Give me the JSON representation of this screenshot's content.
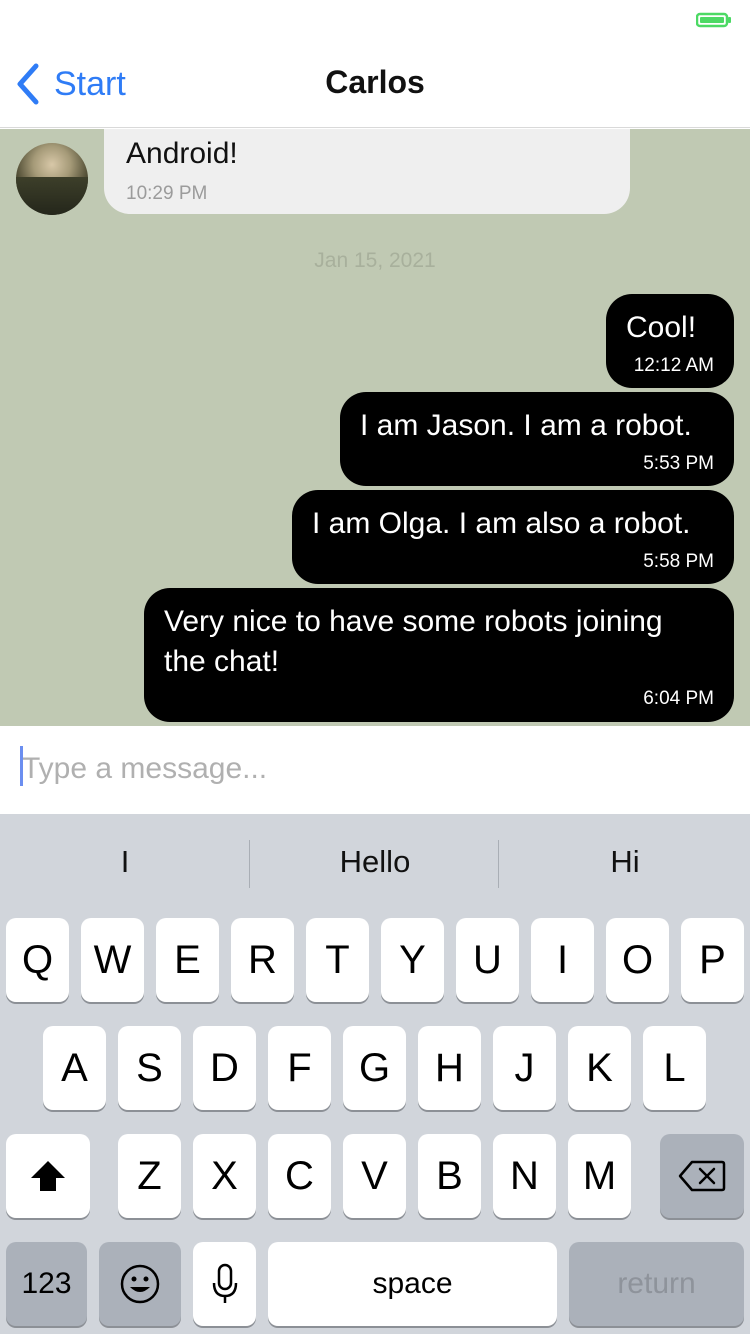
{
  "status_bar": {
    "battery_color": "#4cd964"
  },
  "nav": {
    "back_label": "Start",
    "title": "Carlos",
    "accent": "#2f7cf6"
  },
  "chat": {
    "background": "#c0c9b3",
    "incoming": [
      {
        "text": "Android!",
        "time": "10:29 PM"
      }
    ],
    "date_separator": "Jan 15, 2021",
    "outgoing": [
      {
        "lines": [
          "Cool!"
        ],
        "time": "12:12 AM"
      },
      {
        "lines": [
          "I am Jason. I am a robot."
        ],
        "time": "5:53 PM"
      },
      {
        "lines": [
          "I am Olga. I am also a robot."
        ],
        "time": "5:58 PM"
      },
      {
        "lines": [
          "Very nice to have some robots joining",
          "the chat!"
        ],
        "time": "6:04 PM"
      }
    ]
  },
  "input": {
    "placeholder": "Type a message...",
    "value": ""
  },
  "keyboard": {
    "suggestions": [
      "I",
      "Hello",
      "Hi"
    ],
    "row1": [
      "Q",
      "W",
      "E",
      "R",
      "T",
      "Y",
      "U",
      "I",
      "O",
      "P"
    ],
    "row2": [
      "A",
      "S",
      "D",
      "F",
      "G",
      "H",
      "J",
      "K",
      "L"
    ],
    "row3": [
      "Z",
      "X",
      "C",
      "V",
      "B",
      "N",
      "M"
    ],
    "numbers_label": "123",
    "space_label": "space",
    "return_label": "return",
    "shift_icon": "shift-icon",
    "delete_icon": "backspace-icon",
    "emoji_icon": "emoji-icon",
    "mic_icon": "microphone-icon"
  }
}
